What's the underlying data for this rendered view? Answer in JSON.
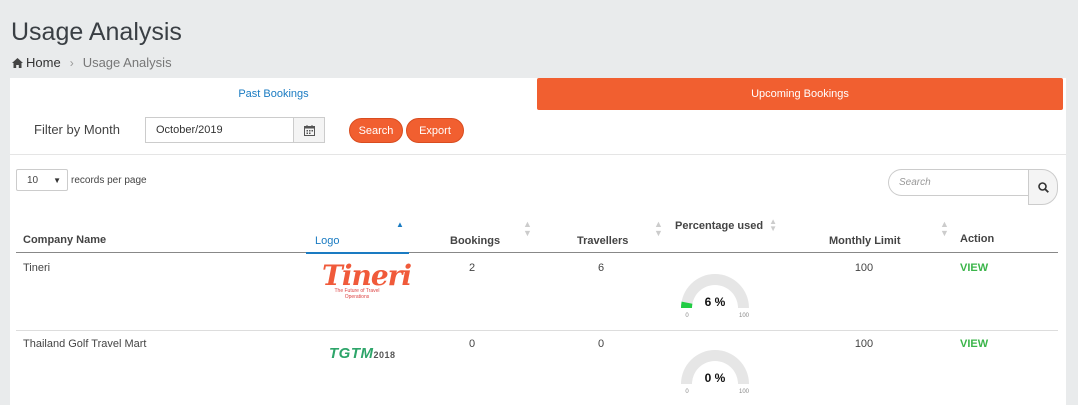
{
  "page_title": "Usage Analysis",
  "breadcrumb": {
    "home": "Home",
    "current": "Usage Analysis"
  },
  "tabs": {
    "past": "Past Bookings",
    "upcoming": "Upcoming Bookings"
  },
  "filter": {
    "label": "Filter by Month",
    "month_value": "October/2019",
    "search_button": "Search",
    "export_button": "Export"
  },
  "table_controls": {
    "page_size": "10",
    "page_size_suffix": "records per page",
    "search_placeholder": "Search"
  },
  "columns": [
    "Company Name",
    "Logo",
    "Bookings",
    "Travellers",
    "Percentage used",
    "Monthly Limit",
    "Action"
  ],
  "rows": [
    {
      "company": "Tineri",
      "logo_text": "Tineri",
      "logo_tagline": "The Future of Travel Operations",
      "bookings": "2",
      "travellers": "6",
      "percent_label": "6 %",
      "percent": 6,
      "gauge_min": "0",
      "gauge_max": "100",
      "monthly_limit": "100",
      "action": "VIEW"
    },
    {
      "company": "Thailand Golf Travel Mart",
      "logo_text": "TGTM",
      "logo_year": "2018",
      "bookings": "0",
      "travellers": "0",
      "percent_label": "0 %",
      "percent": 0,
      "gauge_min": "0",
      "gauge_max": "100",
      "monthly_limit": "100",
      "action": "VIEW"
    }
  ],
  "colors": {
    "accent": "#f15f30",
    "link": "#1a7bc2",
    "view": "#3bb54a",
    "gauge_fill": "#22cc44",
    "gauge_track": "#e6e6e6"
  }
}
